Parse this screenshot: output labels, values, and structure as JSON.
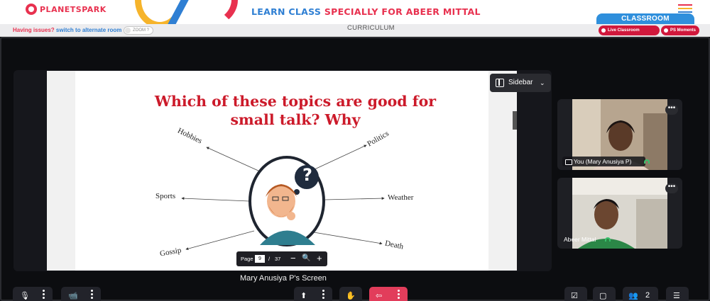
{
  "banner": {
    "logo_text": "PLANETSPARK",
    "title_part1": "LEARN CLASS ",
    "title_part2": "SPECIALLY FOR ABEER MITTAL",
    "classroom_label": "CLASSROOM"
  },
  "strip": {
    "issue_text": "Having issues?",
    "switch_text": "switch to alternate room",
    "toggle_label": "ZOOM ?",
    "curriculum_label": "CURRICULUM",
    "live_support_label": "Live Classroom Support",
    "ps_moments_label": "PS Moments"
  },
  "slide": {
    "title": "Which of these topics are good for small talk? Why",
    "topics": {
      "hobbies": "Hobbies",
      "politics": "Politics",
      "sports": "Sports",
      "weather": "Weather",
      "gossip": "Gossip",
      "death": "Death"
    },
    "thought_mark": "?"
  },
  "sidebar": {
    "label": "Sidebar",
    "chevron": "⌄"
  },
  "pager": {
    "page_label": "Page",
    "current_page": "9",
    "separator": "/",
    "total_pages": "37",
    "zoom_out": "−",
    "zoom_icon": "🔍",
    "zoom_in": "+"
  },
  "screen_label": "Mary Anusiya P's Screen",
  "participants": [
    {
      "name": "You (Mary Anusiya P)",
      "menu": "•••"
    },
    {
      "name": "Abeer Mittal",
      "menu": "•••"
    }
  ],
  "controls": {
    "participants_count": "2"
  },
  "colors": {
    "brand_red": "#e8314f",
    "brand_blue": "#2f7fd3",
    "brand_yellow": "#f6b42b",
    "slide_title": "#cc1a2a",
    "leave_button": "#e23d5b"
  }
}
